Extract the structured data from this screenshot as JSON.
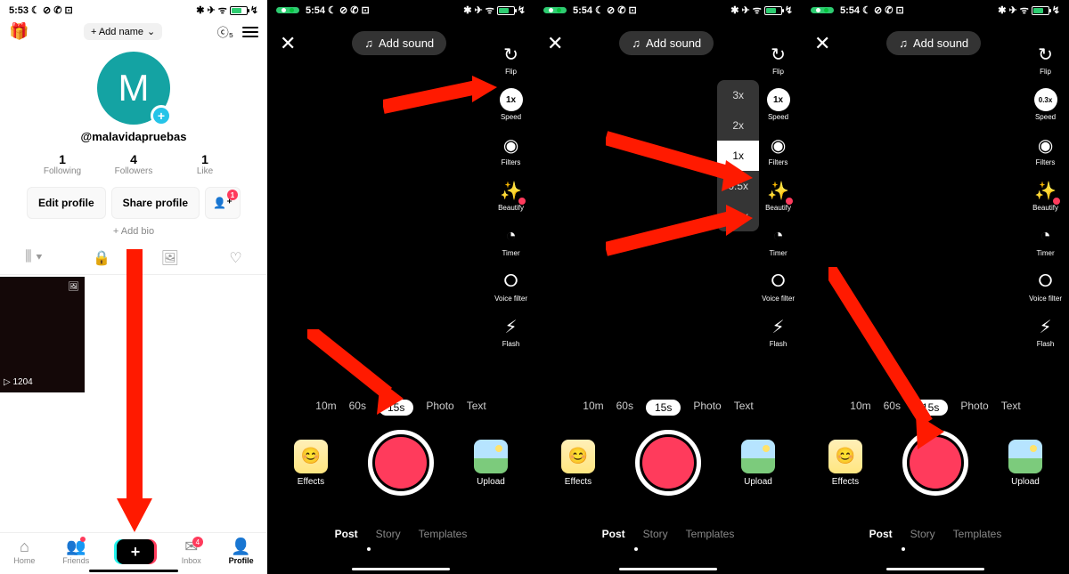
{
  "status": {
    "time_light": "5:53",
    "time_dark": "5:54",
    "left_icons": "☾ ⊘ ✆ ⊡",
    "right_icons": "✱ ✈ ᯤ",
    "bolt": "↯"
  },
  "profile": {
    "add_name": "+ Add name",
    "avatar_letter": "M",
    "handle": "@malavidapruebas",
    "stats": [
      {
        "num": "1",
        "lbl": "Following"
      },
      {
        "num": "4",
        "lbl": "Followers"
      },
      {
        "num": "1",
        "lbl": "Like"
      }
    ],
    "edit": "Edit profile",
    "share": "Share profile",
    "add_user_badge": "1",
    "add_bio": "+ Add bio",
    "coin": "ⓒ₅",
    "views": "▷ 1204"
  },
  "bottom_nav": [
    {
      "lbl": "Home",
      "ico": "⌂"
    },
    {
      "lbl": "Friends",
      "ico": "👥"
    },
    {
      "lbl": "",
      "ico": "+"
    },
    {
      "lbl": "Inbox",
      "ico": "✉",
      "badge": "4"
    },
    {
      "lbl": "Profile",
      "ico": "👤"
    }
  ],
  "camera": {
    "add_sound": "Add sound",
    "tools": [
      {
        "name": "flip",
        "lbl": "Flip",
        "ico": "↻"
      },
      {
        "name": "speed",
        "lbl": "Speed",
        "ico": "1x",
        "alt": "0.3x"
      },
      {
        "name": "filters",
        "lbl": "Filters",
        "ico": "◉"
      },
      {
        "name": "beautify",
        "lbl": "Beautify",
        "ico": "✨"
      },
      {
        "name": "timer",
        "lbl": "Timer",
        "ico": "◔"
      },
      {
        "name": "voice",
        "lbl": "Voice filter",
        "ico": "⭘"
      },
      {
        "name": "flash",
        "lbl": "Flash",
        "ico": "⚡︎"
      }
    ],
    "durations": [
      "10m",
      "60s",
      "15s",
      "Photo",
      "Text"
    ],
    "selected_duration": "15s",
    "effects": "Effects",
    "upload": "Upload",
    "modes": [
      "Post",
      "Story",
      "Templates"
    ],
    "selected_mode": "Post",
    "speed_options": [
      "3x",
      "2x",
      "1x",
      "0.5x",
      "0.3x"
    ],
    "speed_selected": "1x"
  }
}
